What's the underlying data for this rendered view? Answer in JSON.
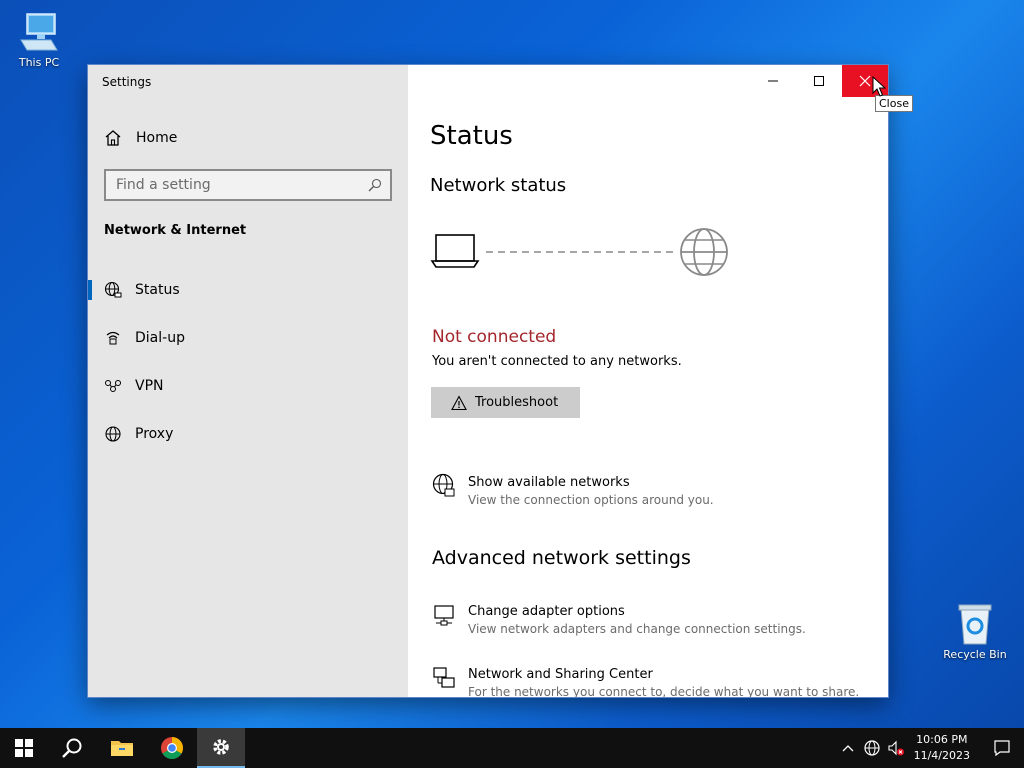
{
  "desktop": {
    "this_pc_label": "This PC",
    "recycle_bin_label": "Recycle Bin"
  },
  "window": {
    "title": "Settings",
    "close_tooltip": "Close"
  },
  "sidebar": {
    "home_label": "Home",
    "search_placeholder": "Find a setting",
    "section_label": "Network & Internet",
    "items": [
      {
        "label": "Status",
        "icon": "globe-status-icon",
        "active": true
      },
      {
        "label": "Dial-up",
        "icon": "dial-up-icon",
        "active": false
      },
      {
        "label": "VPN",
        "icon": "vpn-icon",
        "active": false
      },
      {
        "label": "Proxy",
        "icon": "globe-icon",
        "active": false
      }
    ]
  },
  "main": {
    "page_title": "Status",
    "network_status_heading": "Network status",
    "status_text": "Not connected",
    "status_desc": "You aren't connected to any networks.",
    "troubleshoot_label": "Troubleshoot",
    "show_networks": {
      "title": "Show available networks",
      "desc": "View the connection options around you."
    },
    "advanced_heading": "Advanced network settings",
    "adapter_options": {
      "title": "Change adapter options",
      "desc": "View network adapters and change connection settings."
    },
    "sharing_center": {
      "title": "Network and Sharing Center",
      "desc": "For the networks you connect to, decide what you want to share."
    }
  },
  "taskbar": {
    "time": "10:06 PM",
    "date": "11/4/2023"
  },
  "colors": {
    "accent": "#0067c0",
    "error": "#a4262c",
    "close_hover": "#e81123"
  }
}
